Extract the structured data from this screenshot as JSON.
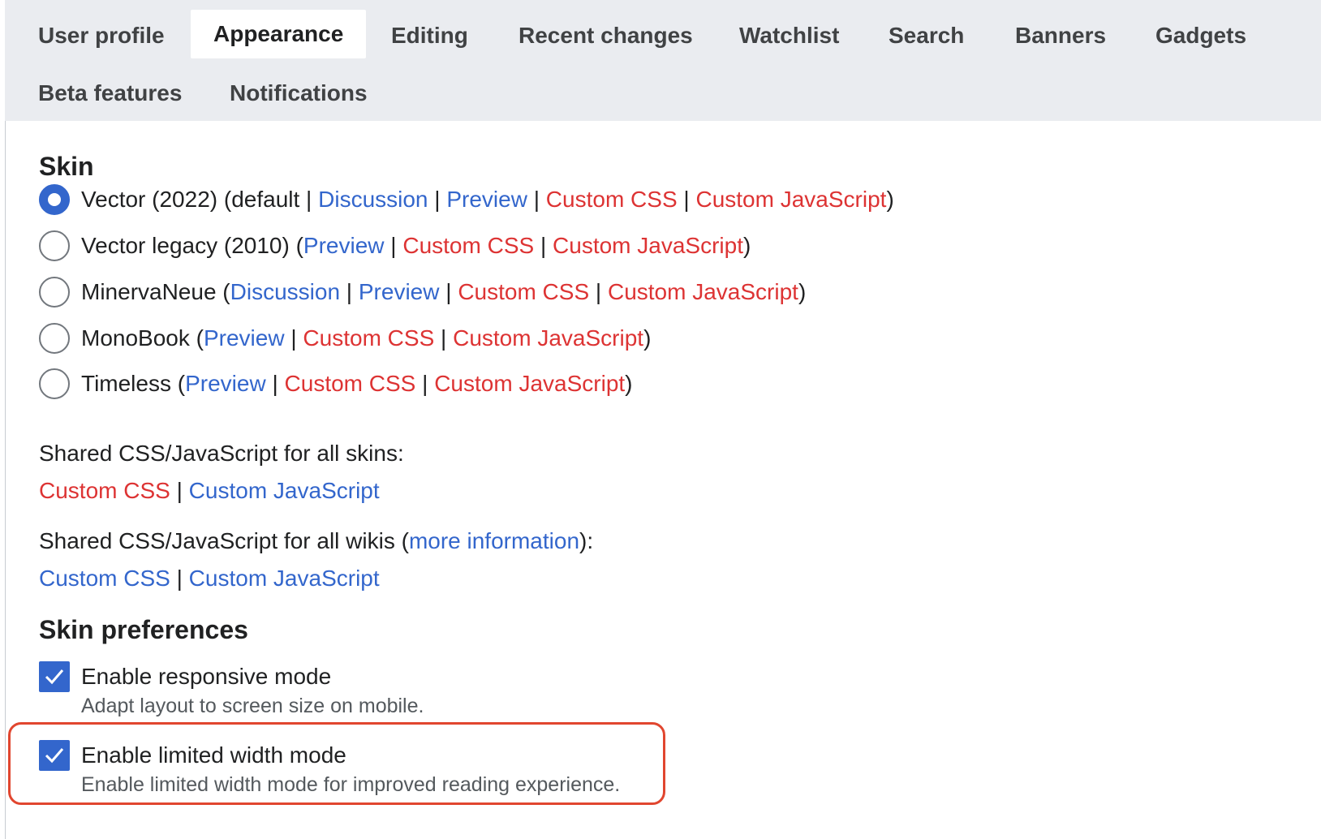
{
  "tabs": [
    {
      "label": "User profile",
      "active": false
    },
    {
      "label": "Appearance",
      "active": true
    },
    {
      "label": "Editing",
      "active": false
    },
    {
      "label": "Recent changes",
      "active": false
    },
    {
      "label": "Watchlist",
      "active": false
    },
    {
      "label": "Search",
      "active": false
    },
    {
      "label": "Banners",
      "active": false
    },
    {
      "label": "Gadgets",
      "active": false
    },
    {
      "label": "Beta features",
      "active": false
    },
    {
      "label": "Notifications",
      "active": false
    }
  ],
  "skin": {
    "heading": "Skin",
    "options": [
      {
        "name": "Vector (2022)",
        "selected": true,
        "prefix": " (default | ",
        "links": [
          {
            "text": "Discussion",
            "color": "blue"
          },
          {
            "text": "Preview",
            "color": "blue"
          },
          {
            "text": "Custom CSS",
            "color": "red"
          },
          {
            "text": "Custom JavaScript",
            "color": "red"
          }
        ]
      },
      {
        "name": "Vector legacy (2010)",
        "selected": false,
        "prefix": " (",
        "links": [
          {
            "text": "Preview",
            "color": "blue"
          },
          {
            "text": "Custom CSS",
            "color": "red"
          },
          {
            "text": "Custom JavaScript",
            "color": "red"
          }
        ]
      },
      {
        "name": "MinervaNeue",
        "selected": false,
        "prefix": " (",
        "links": [
          {
            "text": "Discussion",
            "color": "blue"
          },
          {
            "text": "Preview",
            "color": "blue"
          },
          {
            "text": "Custom CSS",
            "color": "red"
          },
          {
            "text": "Custom JavaScript",
            "color": "red"
          }
        ]
      },
      {
        "name": "MonoBook",
        "selected": false,
        "prefix": " (",
        "links": [
          {
            "text": "Preview",
            "color": "blue"
          },
          {
            "text": "Custom CSS",
            "color": "red"
          },
          {
            "text": "Custom JavaScript",
            "color": "red"
          }
        ]
      },
      {
        "name": "Timeless",
        "selected": false,
        "prefix": " (",
        "links": [
          {
            "text": "Preview",
            "color": "blue"
          },
          {
            "text": "Custom CSS",
            "color": "red"
          },
          {
            "text": "Custom JavaScript",
            "color": "red"
          }
        ]
      }
    ],
    "shared_skins_label": "Shared CSS/JavaScript for all skins:",
    "shared_skins_links": [
      {
        "text": "Custom CSS",
        "color": "red"
      },
      {
        "text": "Custom JavaScript",
        "color": "blue"
      }
    ],
    "shared_wikis_label_before": "Shared CSS/JavaScript for all wikis (",
    "shared_wikis_more_info": "more information",
    "shared_wikis_label_after": "):",
    "shared_wikis_links": [
      {
        "text": "Custom CSS",
        "color": "blue"
      },
      {
        "text": "Custom JavaScript",
        "color": "blue"
      }
    ]
  },
  "skin_preferences": {
    "heading": "Skin preferences",
    "responsive": {
      "label": "Enable responsive mode",
      "help": "Adapt layout to screen size on mobile.",
      "checked": true
    },
    "limited_width": {
      "label": "Enable limited width mode",
      "help": "Enable limited width mode for improved reading experience.",
      "checked": true
    }
  },
  "separator": " | ",
  "colors": {
    "link_blue": "#3366cc",
    "link_red": "#dd3333",
    "highlight": "#e1462f",
    "tab_bg": "#eaecf0"
  }
}
